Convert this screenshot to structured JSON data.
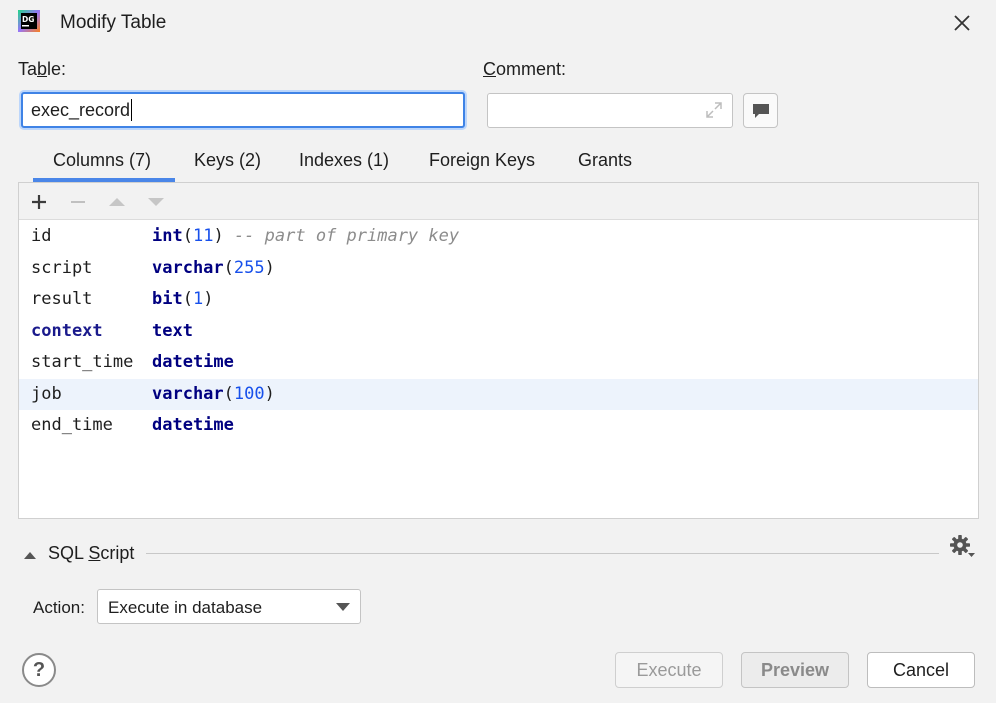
{
  "window": {
    "title": "Modify Table",
    "app_icon_text": "DG"
  },
  "form": {
    "table_label_pre": "Ta",
    "table_label_ul": "b",
    "table_label_post": "le:",
    "table_value": "exec_record",
    "comment_label_ul": "C",
    "comment_label_post": "omment:",
    "comment_value": ""
  },
  "tabs": [
    {
      "label": "Columns (7)",
      "active": true
    },
    {
      "label": "Keys (2)"
    },
    {
      "label": "Indexes (1)"
    },
    {
      "label": "Foreign Keys"
    },
    {
      "label": "Grants"
    }
  ],
  "columns": [
    {
      "name": "id",
      "type_kw": "int",
      "open": "(",
      "size": "11",
      "close": ")",
      "comment": " -- part of primary key",
      "bold": false
    },
    {
      "name": "script",
      "type_kw": "varchar",
      "open": "(",
      "size": "255",
      "close": ")",
      "comment": "",
      "bold": false
    },
    {
      "name": "result",
      "type_kw": "bit",
      "open": "(",
      "size": "1",
      "close": ")",
      "comment": "",
      "bold": false
    },
    {
      "name": "context",
      "type_kw": "text",
      "open": "",
      "size": "",
      "close": "",
      "comment": "",
      "bold": true
    },
    {
      "name": "start_time",
      "type_kw": "datetime",
      "open": "",
      "size": "",
      "close": "",
      "comment": "",
      "bold": false
    },
    {
      "name": "job",
      "type_kw": "varchar",
      "open": "(",
      "size": "100",
      "close": ")",
      "comment": "",
      "bold": false,
      "selected": true
    },
    {
      "name": "end_time",
      "type_kw": "datetime",
      "open": "",
      "size": "",
      "close": "",
      "comment": "",
      "bold": true
    }
  ],
  "sql_script": {
    "label_pre": "SQL ",
    "label_ul": "S",
    "label_post": "cript"
  },
  "action": {
    "label": "Action:",
    "selected": "Execute in database"
  },
  "buttons": {
    "help": "?",
    "execute": "Execute",
    "preview": "Preview",
    "cancel": "Cancel"
  },
  "colors": {
    "accent": "#4a86e8",
    "keyword": "#000080",
    "number": "#1750eb",
    "selected_row": "#edf3fc"
  }
}
